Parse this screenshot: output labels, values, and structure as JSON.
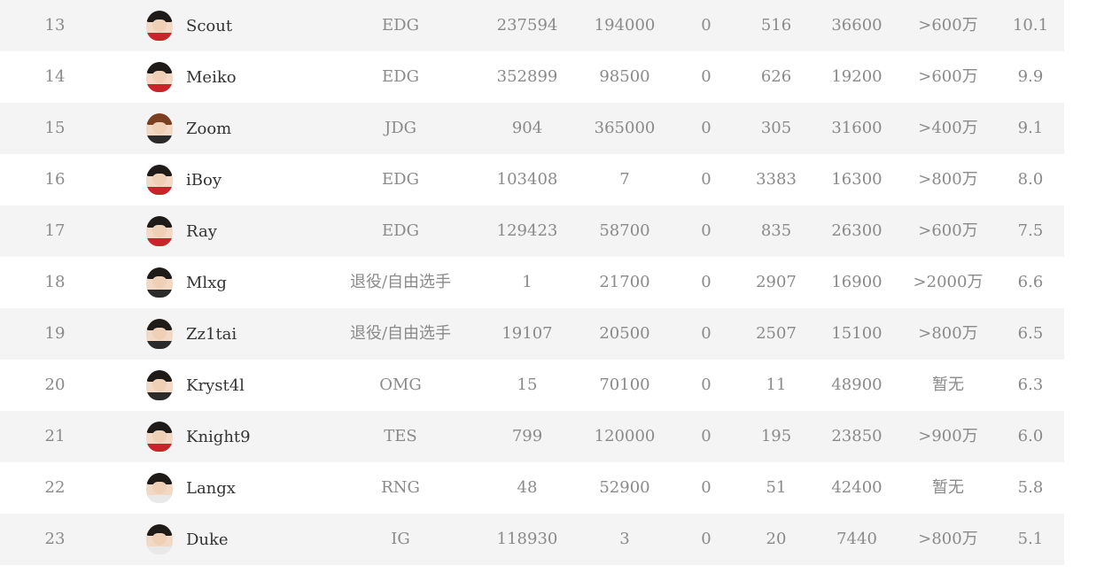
{
  "rows": [
    {
      "rank": "13",
      "name": "Scout",
      "team": "EDG",
      "a": "237594",
      "b": "194000",
      "c": "0",
      "d": "516",
      "e": "36600",
      "f": ">600万",
      "g": "10.1"
    },
    {
      "rank": "14",
      "name": "Meiko",
      "team": "EDG",
      "a": "352899",
      "b": "98500",
      "c": "0",
      "d": "626",
      "e": "19200",
      "f": ">600万",
      "g": "9.9"
    },
    {
      "rank": "15",
      "name": "Zoom",
      "team": "JDG",
      "a": "904",
      "b": "365000",
      "c": "0",
      "d": "305",
      "e": "31600",
      "f": ">400万",
      "g": "9.1"
    },
    {
      "rank": "16",
      "name": "iBoy",
      "team": "EDG",
      "a": "103408",
      "b": "7",
      "c": "0",
      "d": "3383",
      "e": "16300",
      "f": ">800万",
      "g": "8.0"
    },
    {
      "rank": "17",
      "name": "Ray",
      "team": "EDG",
      "a": "129423",
      "b": "58700",
      "c": "0",
      "d": "835",
      "e": "26300",
      "f": ">600万",
      "g": "7.5"
    },
    {
      "rank": "18",
      "name": "Mlxg",
      "team": "退役/自由选手",
      "a": "1",
      "b": "21700",
      "c": "0",
      "d": "2907",
      "e": "16900",
      "f": ">2000万",
      "g": "6.6"
    },
    {
      "rank": "19",
      "name": "Zz1tai",
      "team": "退役/自由选手",
      "a": "19107",
      "b": "20500",
      "c": "0",
      "d": "2507",
      "e": "15100",
      "f": ">800万",
      "g": "6.5"
    },
    {
      "rank": "20",
      "name": "Kryst4l",
      "team": "OMG",
      "a": "15",
      "b": "70100",
      "c": "0",
      "d": "11",
      "e": "48900",
      "f": "暂无",
      "g": "6.3"
    },
    {
      "rank": "21",
      "name": "Knight9",
      "team": "TES",
      "a": "799",
      "b": "120000",
      "c": "0",
      "d": "195",
      "e": "23850",
      "f": ">900万",
      "g": "6.0"
    },
    {
      "rank": "22",
      "name": "Langx",
      "team": "RNG",
      "a": "48",
      "b": "52900",
      "c": "0",
      "d": "51",
      "e": "42400",
      "f": "暂无",
      "g": "5.8"
    },
    {
      "rank": "23",
      "name": "Duke",
      "team": "IG",
      "a": "118930",
      "b": "3",
      "c": "0",
      "d": "20",
      "e": "7440",
      "f": ">800万",
      "g": "5.1"
    }
  ],
  "avatar_styles": [
    "red",
    "red",
    "brown",
    "red",
    "red",
    "dark",
    "dark",
    "dark",
    "red",
    "white",
    "white"
  ],
  "colors": {
    "row_shade": "#f4f4f4",
    "cell_text": "#8a8a8a",
    "name_text": "#333333"
  }
}
